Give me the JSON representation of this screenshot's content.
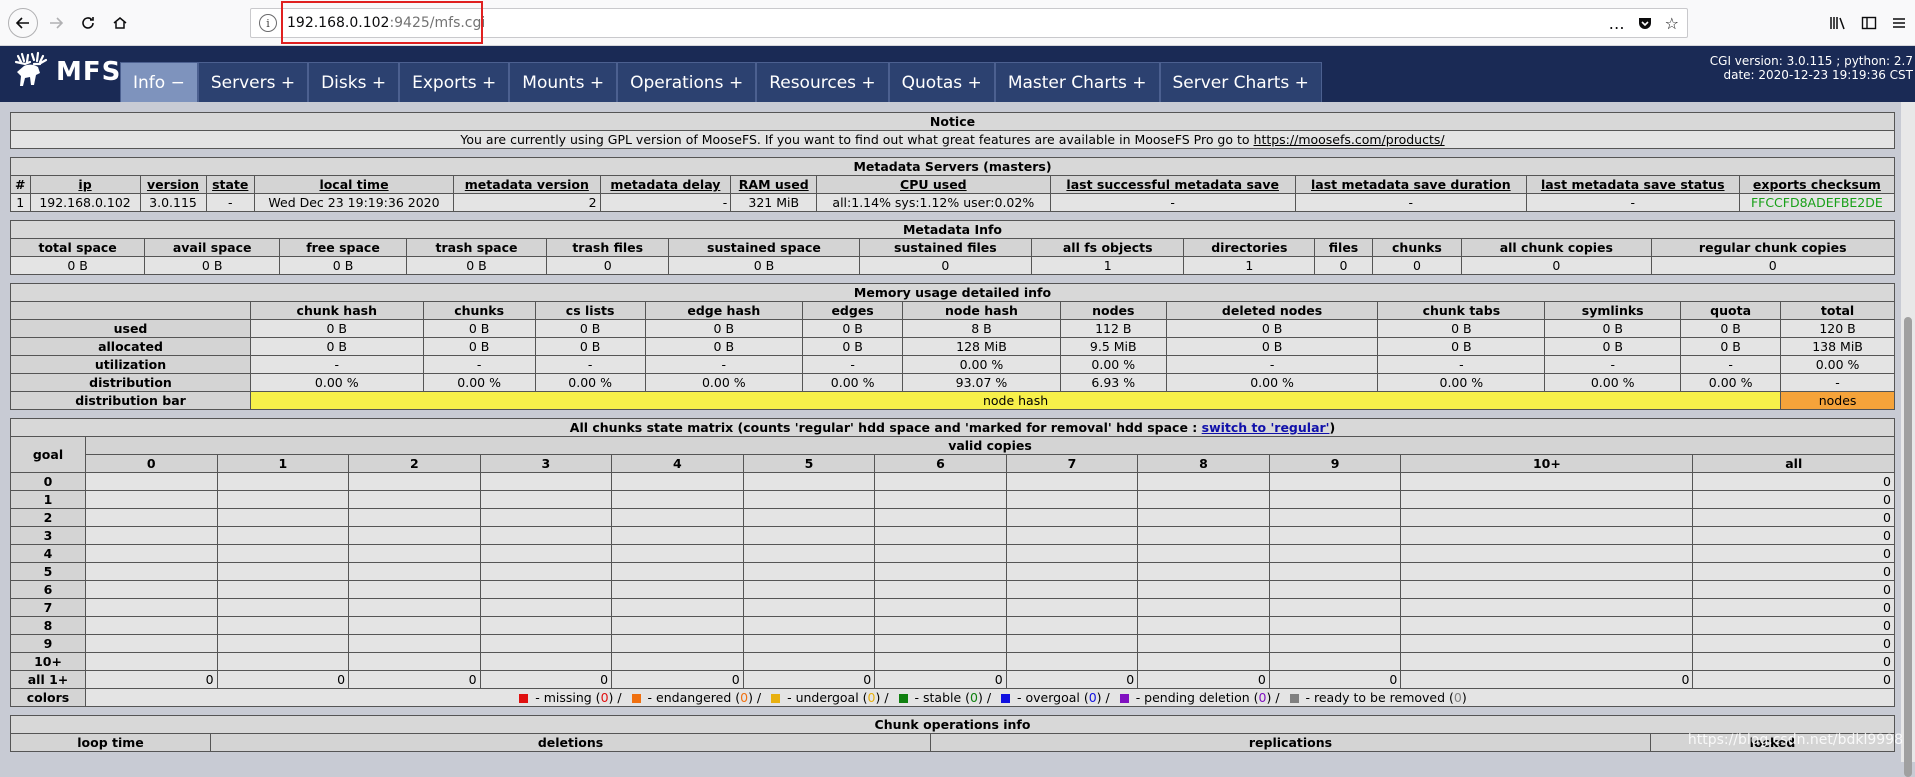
{
  "browser": {
    "url_host": "192.168.0.102",
    "url_rest": ":9425/mfs.cgi",
    "more_icon": "…",
    "pocket_icon": "pocket-icon",
    "star_icon": "☆"
  },
  "header": {
    "logo_text": "MFS",
    "menu": [
      {
        "label": "Info −"
      },
      {
        "label": "Servers +"
      },
      {
        "label": "Disks +"
      },
      {
        "label": "Exports +"
      },
      {
        "label": "Mounts +"
      },
      {
        "label": "Operations +"
      },
      {
        "label": "Resources +"
      },
      {
        "label": "Quotas +"
      },
      {
        "label": "Master Charts +"
      },
      {
        "label": "Server Charts +"
      }
    ],
    "cgi_version": "CGI version: 3.0.115 ; python: 2.7",
    "date": "date: 2020-12-23 19:19:36 CST"
  },
  "notice": {
    "title": "Notice",
    "text": "You are currently using GPL version of MooseFS. If you want to find out what great features are available in MooseFS Pro go to ",
    "link": "https://moosefs.com/products/"
  },
  "masters": {
    "title": "Metadata Servers (masters)",
    "headers": [
      "#",
      "ip",
      "version",
      "state",
      "local time",
      "metadata version",
      "metadata delay",
      "RAM used",
      "CPU used",
      "last successful metadata save",
      "last metadata save duration",
      "last metadata save status",
      "exports checksum"
    ],
    "row": [
      "1",
      "192.168.0.102",
      "3.0.115",
      "-",
      "Wed Dec 23 19:19:36 2020",
      "2",
      "-",
      "321 MiB",
      "all:1.14% sys:1.12% user:0.02%",
      "-",
      "-",
      "-",
      "FFCCFD8ADEFBE2DE"
    ]
  },
  "metainfo": {
    "title": "Metadata Info",
    "headers": [
      "total space",
      "avail space",
      "free space",
      "trash space",
      "trash files",
      "sustained space",
      "sustained files",
      "all fs objects",
      "directories",
      "files",
      "chunks",
      "all chunk copies",
      "regular chunk copies"
    ],
    "row": [
      "0 B",
      "0 B",
      "0 B",
      "0 B",
      "0",
      "0 B",
      "0",
      "1",
      "1",
      "0",
      "0",
      "0",
      "0"
    ]
  },
  "memory": {
    "title": "Memory usage detailed info",
    "headers": [
      "chunk hash",
      "chunks",
      "cs lists",
      "edge hash",
      "edges",
      "node hash",
      "nodes",
      "deleted nodes",
      "chunk tabs",
      "symlinks",
      "quota",
      "total"
    ],
    "rows": [
      {
        "label": "used",
        "values": [
          "0 B",
          "0 B",
          "0 B",
          "0 B",
          "0 B",
          "8 B",
          "112 B",
          "0 B",
          "0 B",
          "0 B",
          "0 B",
          "120 B"
        ]
      },
      {
        "label": "allocated",
        "values": [
          "0 B",
          "0 B",
          "0 B",
          "0 B",
          "0 B",
          "128 MiB",
          "9.5 MiB",
          "0 B",
          "0 B",
          "0 B",
          "0 B",
          "138 MiB"
        ]
      },
      {
        "label": "utilization",
        "values": [
          "-",
          "-",
          "-",
          "-",
          "-",
          "0.00 %",
          "0.00 %",
          "-",
          "-",
          "-",
          "-",
          "0.00 %"
        ]
      },
      {
        "label": "distribution",
        "values": [
          "0.00 %",
          "0.00 %",
          "0.00 %",
          "0.00 %",
          "0.00 %",
          "93.07 %",
          "6.93 %",
          "0.00 %",
          "0.00 %",
          "0.00 %",
          "0.00 %",
          "-"
        ]
      }
    ],
    "bar_label": "distribution bar",
    "bar_node_hash": "node hash",
    "bar_nodes": "nodes"
  },
  "matrix": {
    "title_prefix": "All chunks state matrix (counts 'regular' hdd space and 'marked for removal' hdd space : ",
    "title_link": "switch to 'regular'",
    "title_suffix": ")",
    "goal_label": "goal",
    "valid_copies": "valid copies",
    "columns": [
      "0",
      "1",
      "2",
      "3",
      "4",
      "5",
      "6",
      "7",
      "8",
      "9",
      "10+",
      "all"
    ],
    "goals": [
      "0",
      "1",
      "2",
      "3",
      "4",
      "5",
      "6",
      "7",
      "8",
      "9",
      "10+"
    ],
    "goal_all_value": "0",
    "all_row_label": "all 1+",
    "all_row_values": [
      "0",
      "0",
      "0",
      "0",
      "0",
      "0",
      "0",
      "0",
      "0",
      "0",
      "0",
      "0"
    ],
    "colors_label": "colors",
    "legend": [
      {
        "label": " - missing (",
        "count": "0",
        "tail": ") / "
      },
      {
        "label": " - endangered (",
        "count": "0",
        "tail": ") / "
      },
      {
        "label": " - undergoal (",
        "count": "0",
        "tail": ") / "
      },
      {
        "label": " - stable (",
        "count": "0",
        "tail": ") / "
      },
      {
        "label": " - overgoal (",
        "count": "0",
        "tail": ") / "
      },
      {
        "label": " - pending deletion (",
        "count": "0",
        "tail": ") / "
      },
      {
        "label": " - ready to be removed (",
        "count": "0",
        "tail": ")"
      }
    ]
  },
  "chunkops": {
    "title": "Chunk operations info",
    "headers": [
      "loop time",
      "deletions",
      "replications",
      "locked"
    ]
  },
  "watermark": "https://blog.csdn.net/bdkl9998",
  "colors": {
    "header_bg": "#1a2a55",
    "menu_bg": "#2c4170",
    "menu_active": "#7e93bd",
    "checksum": "#18a018"
  }
}
